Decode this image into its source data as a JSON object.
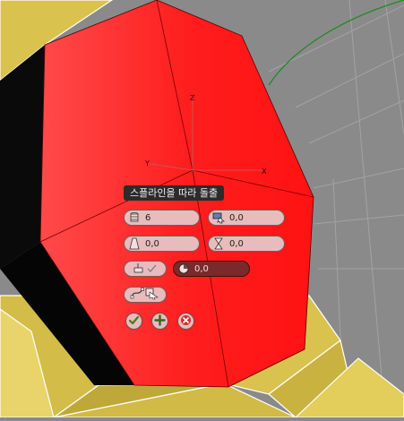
{
  "caddy": {
    "title": "스플라인을 따라 돌출",
    "segments": {
      "value": "6",
      "icon": "segments-icon"
    },
    "align": {
      "value": "0,0",
      "icon": "align-to-face-icon"
    },
    "taper": {
      "value": "0,0",
      "icon": "taper-amount-icon"
    },
    "twist": {
      "value": "0,0",
      "icon": "twist-icon"
    },
    "rotation": {
      "value": "0,0",
      "icon": "rotation-icon"
    },
    "taper_curve": {
      "icon": "taper-curve-icon"
    },
    "pick_spline": {
      "icon": "pick-spline-icon"
    }
  },
  "actions": {
    "ok": "ok-check-icon",
    "apply": "apply-plus-icon",
    "cancel": "cancel-x-icon"
  },
  "gizmo": {
    "axes": [
      "Z",
      "Y",
      "X"
    ]
  },
  "colors": {
    "face": "#ff2020",
    "mesh_gold": "#d9c24d",
    "viewport_bg": "#8a8a8a",
    "spline": "#1a8a1a",
    "caddy_field": "#e8bcbc",
    "caddy_field_active": "#7a2a2a"
  }
}
